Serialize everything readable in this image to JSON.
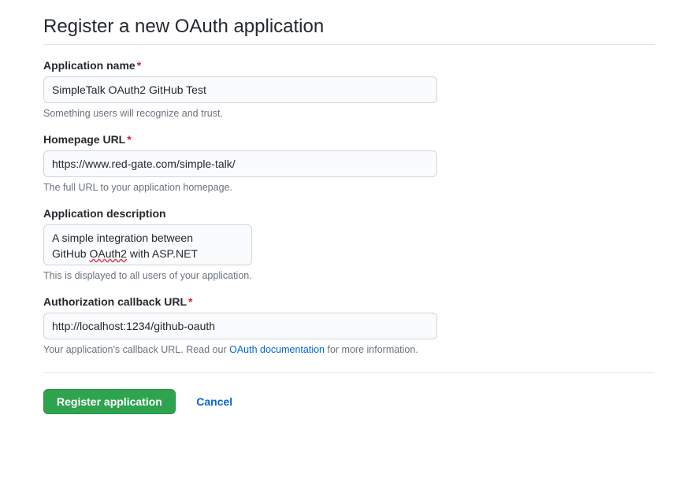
{
  "title": "Register a new OAuth application",
  "fields": {
    "appName": {
      "label": "Application name",
      "value": "SimpleTalk OAuth2 GitHub Test",
      "note": "Something users will recognize and trust."
    },
    "homepage": {
      "label": "Homepage URL",
      "value": "https://www.red-gate.com/simple-talk/",
      "note": "The full URL to your application homepage."
    },
    "description": {
      "label": "Application description",
      "value_line1": "A simple integration between ",
      "value_line2_prefix": "GitHub ",
      "value_line2_err": "OAuth2",
      "value_line2_suffix": " with ASP.NET",
      "note": "This is displayed to all users of your application."
    },
    "callback": {
      "label": "Authorization callback URL",
      "value": "http://localhost:1234/github-oauth",
      "note_prefix": "Your application's callback URL. Read our ",
      "note_link": "OAuth documentation",
      "note_suffix": " for more information."
    }
  },
  "actions": {
    "submit": "Register application",
    "cancel": "Cancel"
  }
}
